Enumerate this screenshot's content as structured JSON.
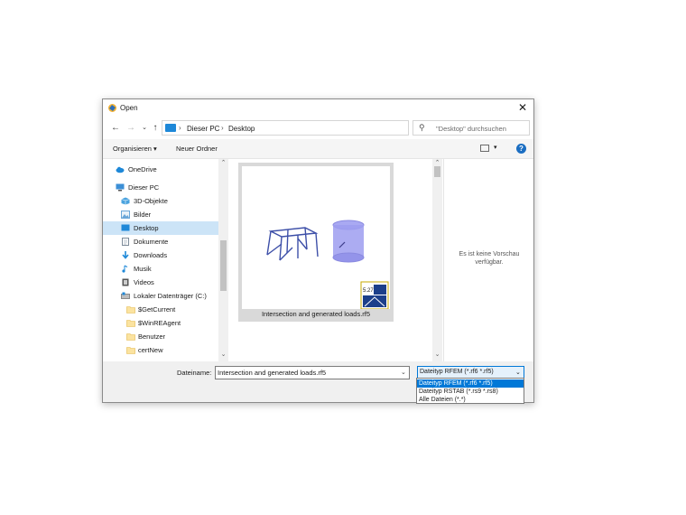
{
  "window": {
    "title": "Open"
  },
  "address": {
    "crumbs": [
      "Dieser PC",
      "Desktop"
    ],
    "search_placeholder": "\"Desktop\" durchsuchen"
  },
  "toolbar": {
    "organize": "Organisieren ▾",
    "new_folder": "Neuer Ordner"
  },
  "sidebar": {
    "items": [
      {
        "label": "OneDrive",
        "icon": "cloud-icon",
        "color": "#1e88d8"
      },
      {
        "label": "Dieser PC",
        "icon": "computer-icon",
        "color": "#3c8fd6"
      },
      {
        "label": "3D-Objekte",
        "icon": "cube-icon",
        "color": "#4aa3df"
      },
      {
        "label": "Bilder",
        "icon": "pictures-icon",
        "color": "#6aa6d8"
      },
      {
        "label": "Desktop",
        "icon": "desktop-icon",
        "color": "#1e88d8",
        "selected": true
      },
      {
        "label": "Dokumente",
        "icon": "document-icon",
        "color": "#7d8b99"
      },
      {
        "label": "Downloads",
        "icon": "download-icon",
        "color": "#1e88d8"
      },
      {
        "label": "Musik",
        "icon": "music-icon",
        "color": "#1e88d8"
      },
      {
        "label": "Videos",
        "icon": "video-icon",
        "color": "#555555"
      },
      {
        "label": "Lokaler Datenträger (C:)",
        "icon": "drive-icon",
        "color": "#8a8a8a"
      },
      {
        "label": "$GetCurrent",
        "icon": "folder-icon",
        "color": "#f5d06a"
      },
      {
        "label": "$WinREAgent",
        "icon": "folder-icon",
        "color": "#f5d06a"
      },
      {
        "label": "Benutzer",
        "icon": "folder-icon",
        "color": "#f5d06a"
      },
      {
        "label": "certNew",
        "icon": "folder-icon",
        "color": "#f5d06a"
      }
    ]
  },
  "file": {
    "name": "Intersection and generated loads.rf5",
    "badge_number": "5.27"
  },
  "preview": {
    "text_line1": "Es ist keine Vorschau",
    "text_line2": "verfügbar."
  },
  "bottom": {
    "filename_label": "Dateiname:",
    "filename_value": "Intersection and generated loads.rf5",
    "filetype_value": "Dateityp RFEM (*.rf6 *.rf5)"
  },
  "filetype_options": [
    "Dateityp RFEM (*.rf6 *.rf5)",
    "Dateityp RSTAB (*.rs9 *.rs8)",
    "Alle Dateien (*.*)"
  ]
}
